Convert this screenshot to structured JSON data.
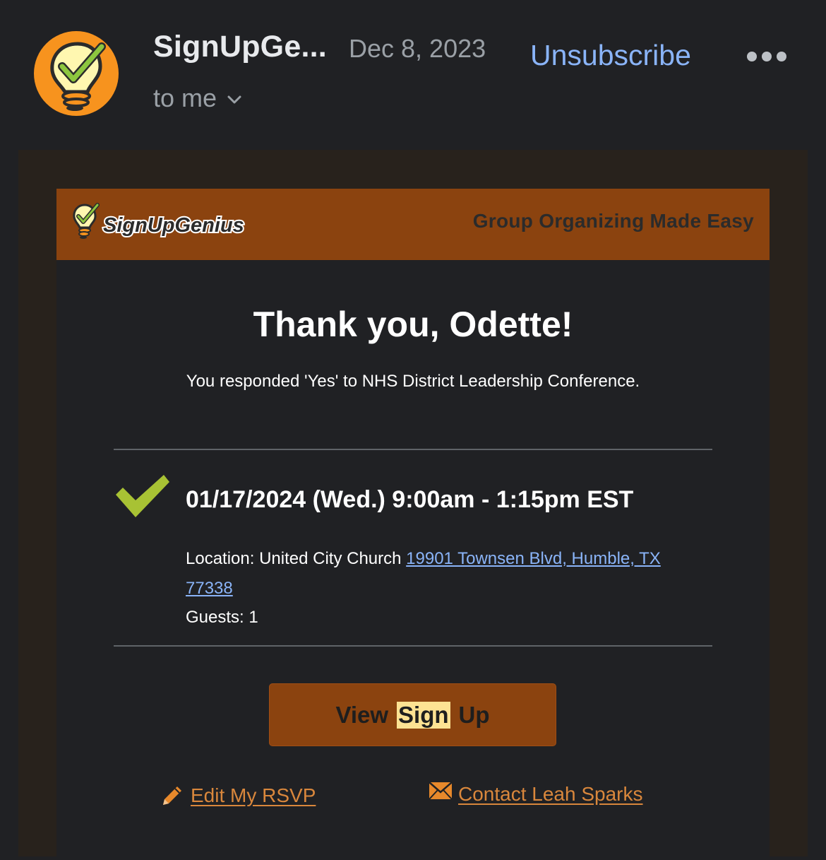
{
  "header": {
    "sender_name": "SignUpGe...",
    "date": "Dec 8, 2023",
    "unsubscribe_label": "Unsubscribe",
    "recipient_label": "to me"
  },
  "email": {
    "brand_name": "SignUpGenius",
    "tagline": "Group Organizing Made Easy",
    "heading": "Thank you, Odette!",
    "response_text": "You responded 'Yes' to NHS District Leadership Conference.",
    "slot": {
      "datetime": "01/17/2024 (Wed.) 9:00am - 1:15pm EST",
      "location_prefix": "Location: United City Church",
      "location_address": "19901 Townsen Blvd, Humble, TX 77338",
      "guests": "Guests: 1"
    },
    "button": {
      "word1": "View",
      "word2": "Sign",
      "word3": "Up"
    },
    "links": {
      "edit_rsvp": "Edit My RSVP",
      "contact": "Contact Leah Sparks"
    }
  },
  "colors": {
    "banner": "#8b430f",
    "link": "#8ab4f8",
    "accent_link": "#d9873c",
    "check": "#a8c234",
    "avatar_bg": "#f7931e"
  }
}
